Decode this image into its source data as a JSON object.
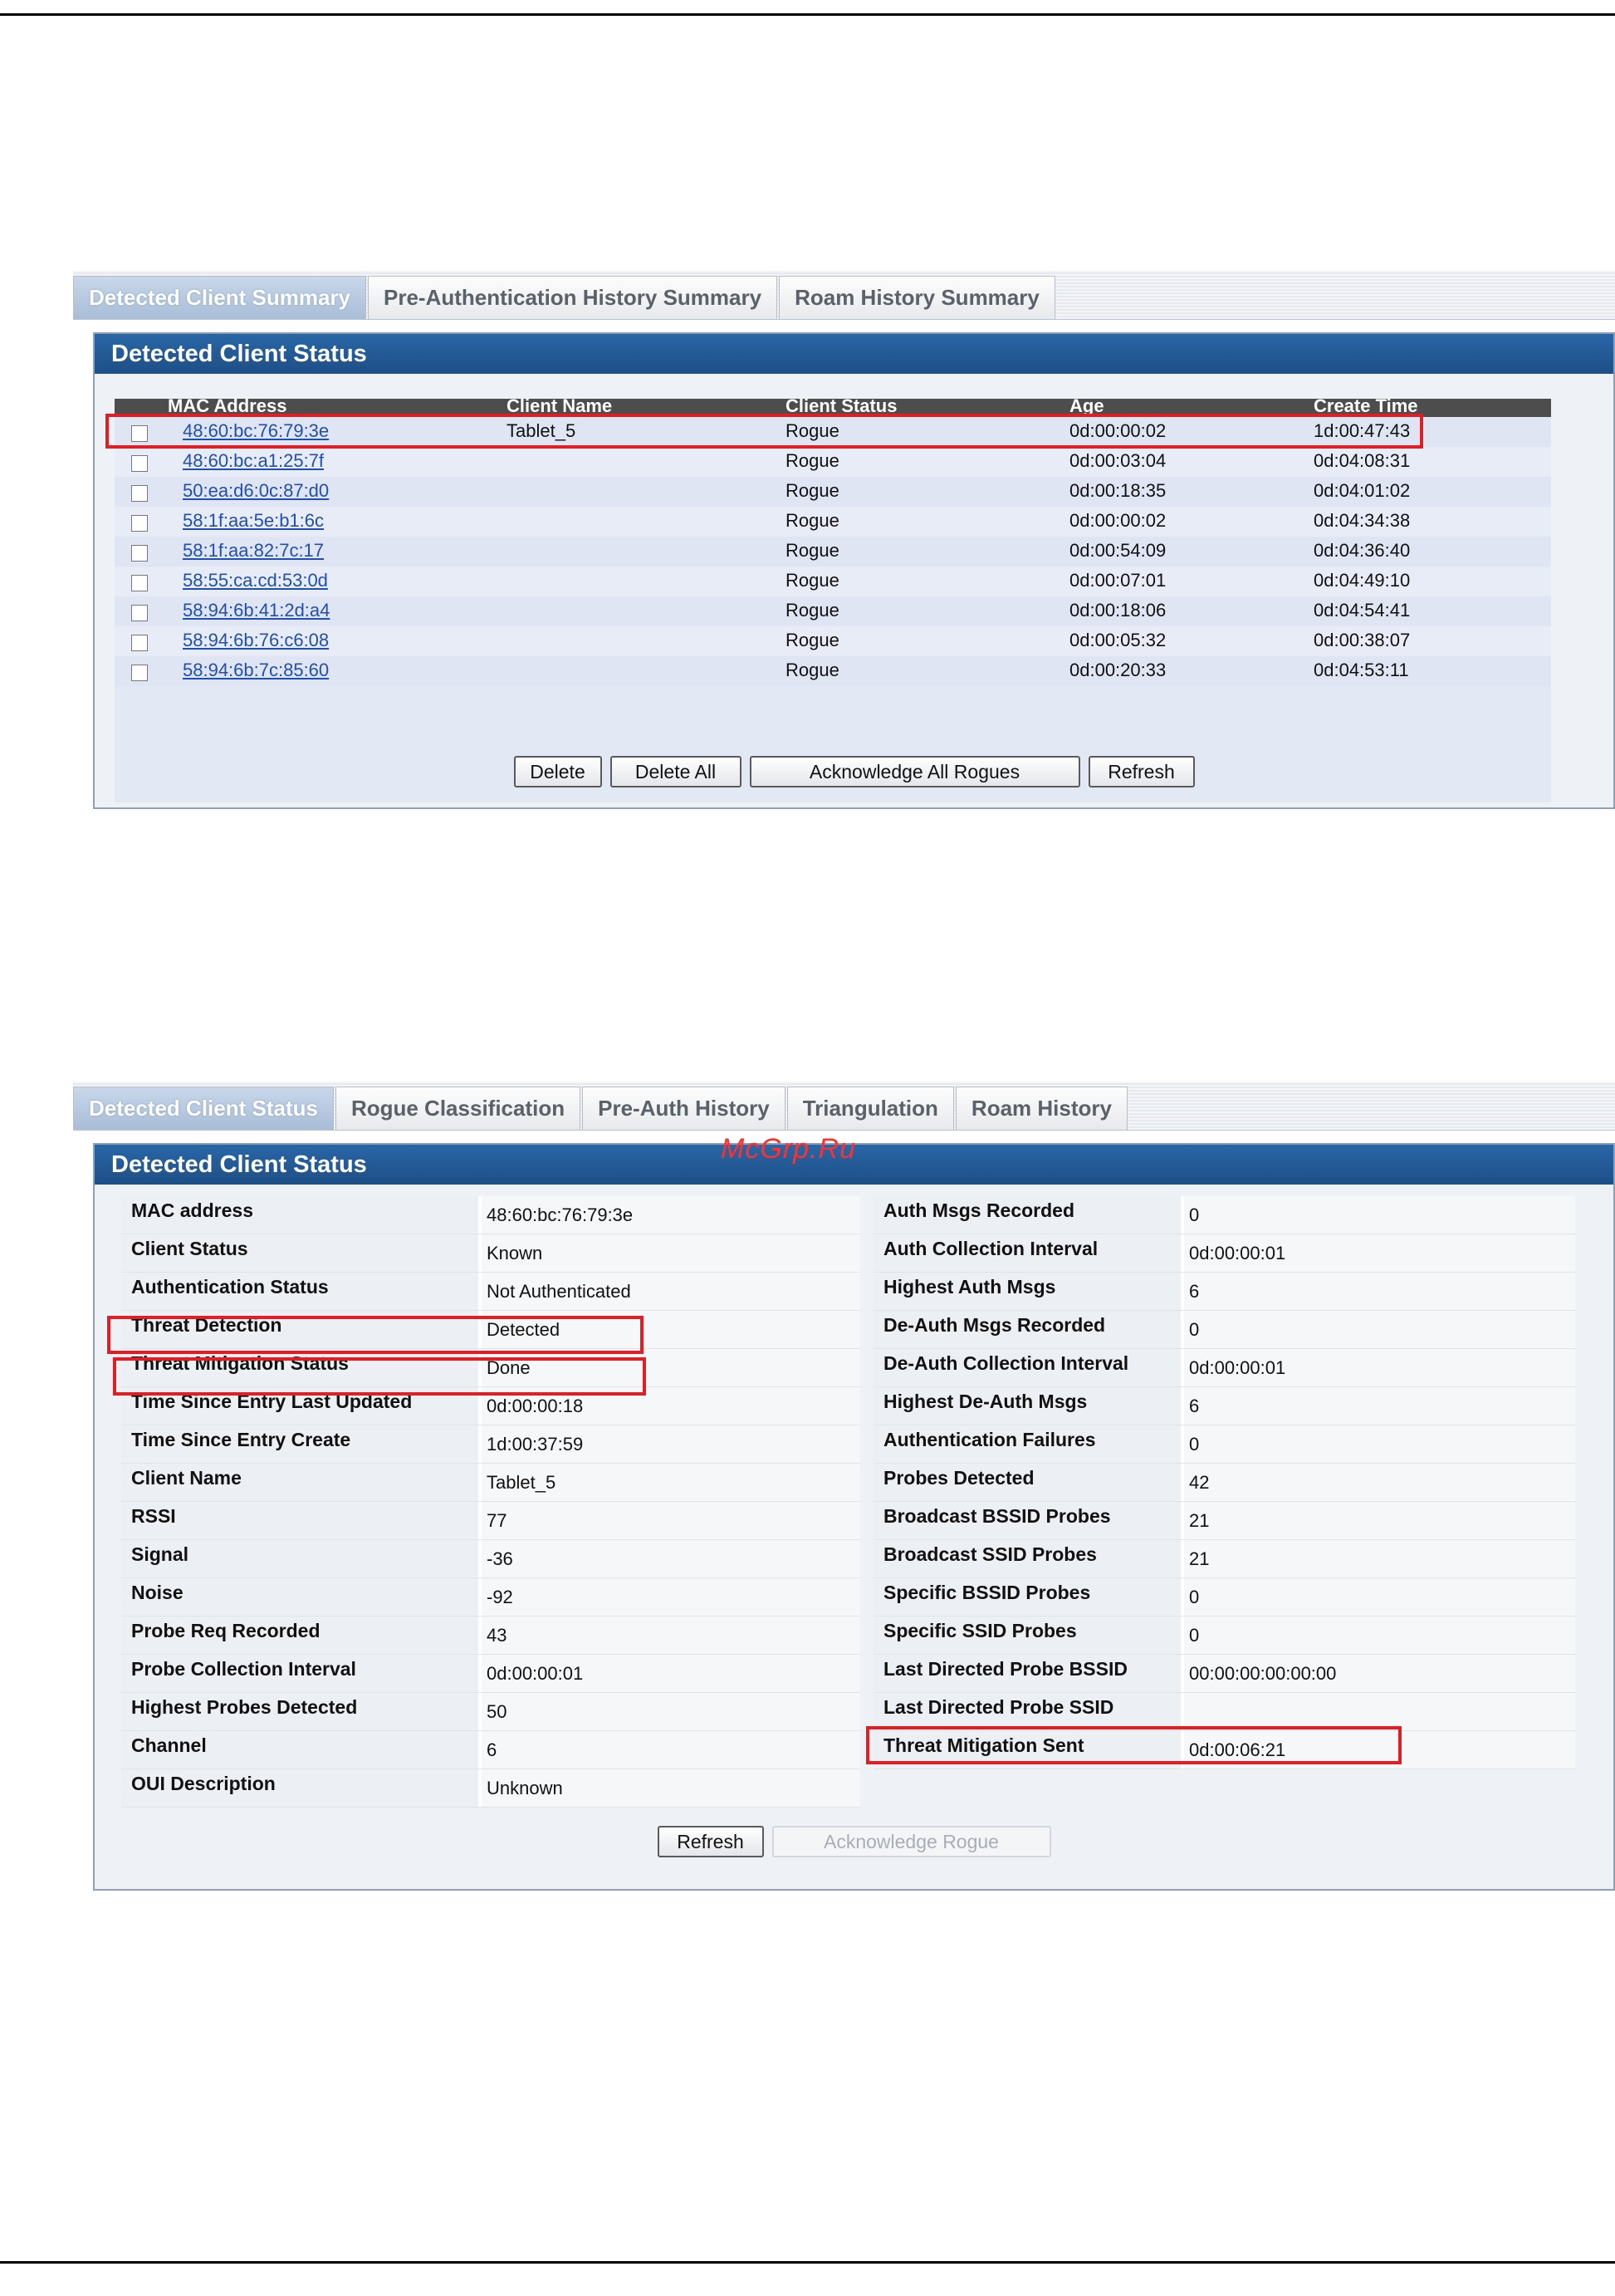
{
  "summary": {
    "tabs": [
      "Detected Client Summary",
      "Pre-Authentication History Summary",
      "Roam History Summary"
    ],
    "panel_title": "Detected Client Status",
    "columns": [
      "MAC Address",
      "Client Name",
      "Client Status",
      "Age",
      "Create Time"
    ],
    "rows": [
      {
        "mac": "48:60:bc:76:79:3e",
        "name": "Tablet_5",
        "status": "Rogue",
        "age": "0d:00:00:02",
        "create": "1d:00:47:43"
      },
      {
        "mac": "48:60:bc:a1:25:7f",
        "name": "",
        "status": "Rogue",
        "age": "0d:00:03:04",
        "create": "0d:04:08:31"
      },
      {
        "mac": "50:ea:d6:0c:87:d0",
        "name": "",
        "status": "Rogue",
        "age": "0d:00:18:35",
        "create": "0d:04:01:02"
      },
      {
        "mac": "58:1f:aa:5e:b1:6c",
        "name": "",
        "status": "Rogue",
        "age": "0d:00:00:02",
        "create": "0d:04:34:38"
      },
      {
        "mac": "58:1f:aa:82:7c:17",
        "name": "",
        "status": "Rogue",
        "age": "0d:00:54:09",
        "create": "0d:04:36:40"
      },
      {
        "mac": "58:55:ca:cd:53:0d",
        "name": "",
        "status": "Rogue",
        "age": "0d:00:07:01",
        "create": "0d:04:49:10"
      },
      {
        "mac": "58:94:6b:41:2d:a4",
        "name": "",
        "status": "Rogue",
        "age": "0d:00:18:06",
        "create": "0d:04:54:41"
      },
      {
        "mac": "58:94:6b:76:c6:08",
        "name": "",
        "status": "Rogue",
        "age": "0d:00:05:32",
        "create": "0d:00:38:07"
      },
      {
        "mac": "58:94:6b:7c:85:60",
        "name": "",
        "status": "Rogue",
        "age": "0d:00:20:33",
        "create": "0d:04:53:11"
      }
    ],
    "buttons": {
      "delete": "Delete",
      "delete_all": "Delete All",
      "ack_all": "Acknowledge All Rogues",
      "refresh": "Refresh"
    }
  },
  "detail": {
    "tabs": [
      "Detected Client Status",
      "Rogue Classification",
      "Pre-Auth History",
      "Triangulation",
      "Roam History"
    ],
    "panel_title": "Detected Client Status",
    "left": [
      {
        "label": "MAC address",
        "value": "48:60:bc:76:79:3e"
      },
      {
        "label": "Client Status",
        "value": "Known"
      },
      {
        "label": "Authentication Status",
        "value": "Not Authenticated"
      },
      {
        "label": "Threat Detection",
        "value": "Detected"
      },
      {
        "label": "Threat Mitigation Status",
        "value": "Done"
      },
      {
        "label": "Time Since Entry Last Updated",
        "value": "0d:00:00:18"
      },
      {
        "label": "Time Since Entry Create",
        "value": "1d:00:37:59"
      },
      {
        "label": "Client Name",
        "value": "Tablet_5"
      },
      {
        "label": "RSSI",
        "value": "77"
      },
      {
        "label": "Signal",
        "value": "-36"
      },
      {
        "label": "Noise",
        "value": "-92"
      },
      {
        "label": "Probe Req Recorded",
        "value": "43"
      },
      {
        "label": "Probe Collection Interval",
        "value": "0d:00:00:01"
      },
      {
        "label": "Highest Probes Detected",
        "value": "50"
      },
      {
        "label": "Channel",
        "value": "6"
      },
      {
        "label": "OUI Description",
        "value": "Unknown"
      }
    ],
    "right": [
      {
        "label": "Auth Msgs Recorded",
        "value": "0"
      },
      {
        "label": "Auth Collection Interval",
        "value": "0d:00:00:01"
      },
      {
        "label": "Highest Auth Msgs",
        "value": "6"
      },
      {
        "label": "De-Auth Msgs Recorded",
        "value": "0"
      },
      {
        "label": "De-Auth Collection Interval",
        "value": "0d:00:00:01"
      },
      {
        "label": "Highest De-Auth Msgs",
        "value": "6"
      },
      {
        "label": "Authentication Failures",
        "value": "0"
      },
      {
        "label": "Probes Detected",
        "value": "42"
      },
      {
        "label": "Broadcast BSSID Probes",
        "value": "21"
      },
      {
        "label": "Broadcast SSID Probes",
        "value": "21"
      },
      {
        "label": "Specific BSSID Probes",
        "value": "0"
      },
      {
        "label": "Specific SSID Probes",
        "value": "0"
      },
      {
        "label": "Last Directed Probe BSSID",
        "value": "00:00:00:00:00:00"
      },
      {
        "label": "Last Directed Probe SSID",
        "value": ""
      },
      {
        "label": "Threat Mitigation Sent",
        "value": "0d:00:06:21"
      }
    ],
    "buttons": {
      "refresh": "Refresh",
      "ack_rogue": "Acknowledge Rogue"
    }
  },
  "watermark": "McGrp.Ru"
}
